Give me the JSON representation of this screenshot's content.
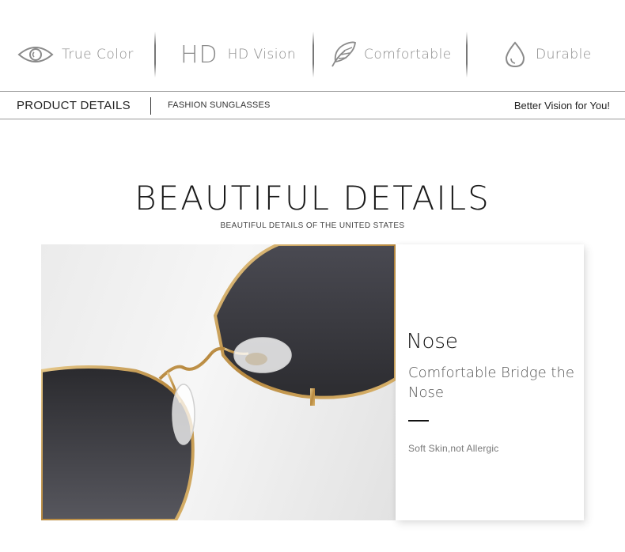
{
  "features": {
    "true_color": "True Color",
    "hd_mark": "HD",
    "hd_vision": "HD Vision",
    "comfortable": "Comfortable",
    "durable": "Durable"
  },
  "bar": {
    "product_details": "PRODUCT DETAILS",
    "category": "FASHION SUNGLASSES",
    "tagline": "Better Vision for You!"
  },
  "section": {
    "title": "BEAUTIFUL DETAILS",
    "subtitle": "BEAUTIFUL DETAILS OF THE UNITED STATES"
  },
  "detail": {
    "heading": "Nose",
    "description": "Comfortable Bridge the Nose",
    "note": "Soft Skin,not Allergic"
  },
  "colors": {
    "frame_gold": "#c9a05a",
    "lens_dark": "#3a3a40"
  }
}
